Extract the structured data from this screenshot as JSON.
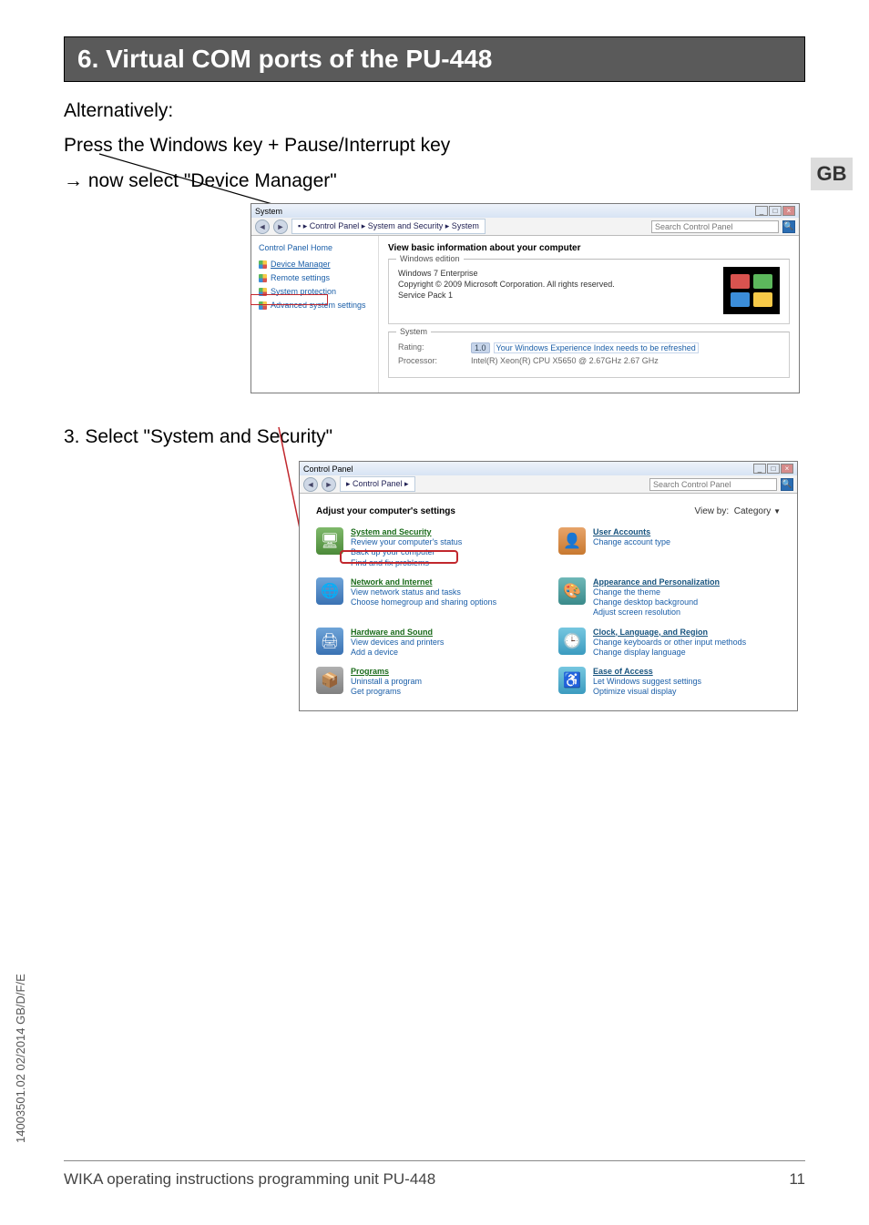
{
  "heading": "6. Virtual COM ports of the PU-448",
  "intro": {
    "line1": "Alternatively:",
    "line2": "Press the Windows key + Pause/Interrupt key",
    "line3": "→ now select \"Device Manager\""
  },
  "lang_tag": "GB",
  "system_window": {
    "title": "System",
    "breadcrumb": "▪ ▸ Control Panel ▸ System and Security ▸ System",
    "search_placeholder": "Search Control Panel",
    "left": {
      "home": "Control Panel Home",
      "device_manager": "Device Manager",
      "remote": "Remote settings",
      "protection": "System protection",
      "advanced": "Advanced system settings"
    },
    "main_header": "View basic information about your computer",
    "edition": {
      "legend": "Windows edition",
      "line1": "Windows 7 Enterprise",
      "line2": "Copyright © 2009 Microsoft Corporation.  All rights reserved.",
      "line3": "Service Pack 1"
    },
    "system": {
      "legend": "System",
      "rating_label": "Rating:",
      "rating_score": "1.0",
      "rating_text": "Your Windows Experience Index needs to be refreshed",
      "processor_label": "Processor:",
      "processor_value": "Intel(R) Xeon(R) CPU      X5650  @ 2.67GHz   2.67 GHz"
    }
  },
  "step3": "3. Select \"System and Security\"",
  "control_panel": {
    "title": "Control Panel",
    "breadcrumb": "▸ Control Panel ▸",
    "search_placeholder": "Search Control Panel",
    "adjust": "Adjust your computer's settings",
    "viewby_label": "View by:",
    "viewby_value": "Category",
    "cats": [
      {
        "title": "System and Security",
        "subs": [
          "Review your computer's status",
          "Back up your computer",
          "Find and fix problems"
        ]
      },
      {
        "title": "User Accounts",
        "subs": [
          "Change account type"
        ]
      },
      {
        "title": "Network and Internet",
        "subs": [
          "View network status and tasks",
          "Choose homegroup and sharing options"
        ]
      },
      {
        "title": "Appearance and Personalization",
        "subs": [
          "Change the theme",
          "Change desktop background",
          "Adjust screen resolution"
        ]
      },
      {
        "title": "Hardware and Sound",
        "subs": [
          "View devices and printers",
          "Add a device"
        ]
      },
      {
        "title": "Clock, Language, and Region",
        "subs": [
          "Change keyboards or other input methods",
          "Change display language"
        ]
      },
      {
        "title": "Programs",
        "subs": [
          "Uninstall a program",
          "Get programs"
        ]
      },
      {
        "title": "Ease of Access",
        "subs": [
          "Let Windows suggest settings",
          "Optimize visual display"
        ]
      }
    ]
  },
  "footer": {
    "side": "14003501.02 02/2014 GB/D/F/E",
    "left": "WIKA operating instructions programming unit PU-448",
    "page": "11"
  }
}
